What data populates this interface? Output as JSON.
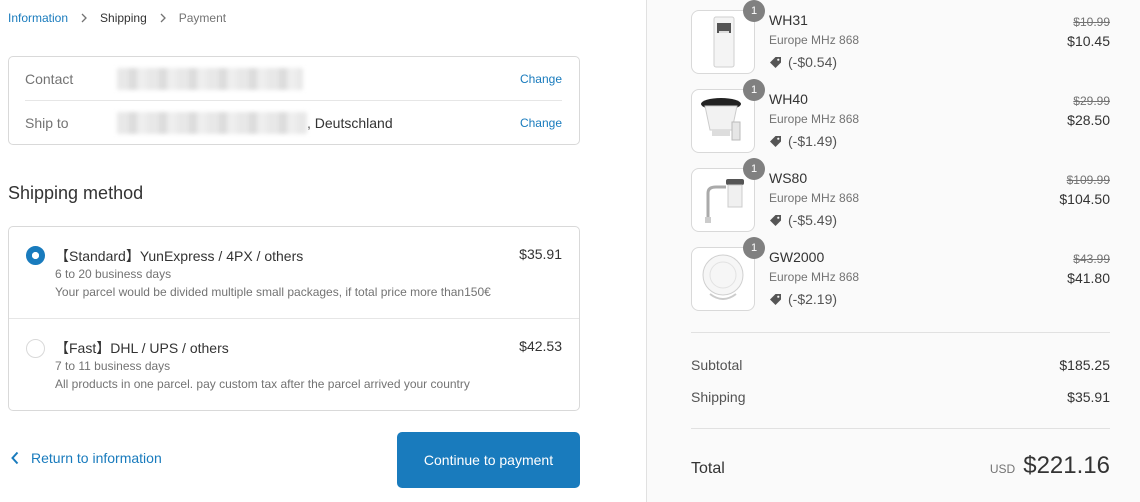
{
  "breadcrumb": {
    "items": [
      {
        "label": "Information",
        "state": "link"
      },
      {
        "label": "Shipping",
        "state": "current"
      },
      {
        "label": "Payment",
        "state": "upcoming"
      }
    ]
  },
  "review": {
    "contact_label": "Contact",
    "contact_change": "Change",
    "shipto_label": "Ship to",
    "shipto_value_suffix": ", Deutschland",
    "shipto_change": "Change"
  },
  "shipping_method": {
    "title": "Shipping method",
    "options": [
      {
        "selected": true,
        "title": "【Standard】YunExpress / 4PX / others",
        "price": "$35.91",
        "days": "6 to 20 business days",
        "note": "Your parcel would be divided multiple small packages, if total price more than150€"
      },
      {
        "selected": false,
        "title": "【Fast】DHL / UPS / others",
        "price": "$42.53",
        "days": "7 to 11 business days",
        "note": "All products in one parcel. pay custom tax after the parcel arrived your country"
      }
    ]
  },
  "footer": {
    "return_label": "Return to information",
    "continue_label": "Continue to payment"
  },
  "products": [
    {
      "name": "WH31",
      "variant": "Europe MHz 868",
      "discount": "(-$0.54)",
      "old_price": "$10.99",
      "price": "$10.45",
      "qty": "1"
    },
    {
      "name": "WH40",
      "variant": "Europe MHz 868",
      "discount": "(-$1.49)",
      "old_price": "$29.99",
      "price": "$28.50",
      "qty": "1"
    },
    {
      "name": "WS80",
      "variant": "Europe MHz 868",
      "discount": "(-$5.49)",
      "old_price": "$109.99",
      "price": "$104.50",
      "qty": "1"
    },
    {
      "name": "GW2000",
      "variant": "Europe MHz 868",
      "discount": "(-$2.19)",
      "old_price": "$43.99",
      "price": "$41.80",
      "qty": "1"
    }
  ],
  "summary": {
    "subtotal_label": "Subtotal",
    "subtotal_value": "$185.25",
    "shipping_label": "Shipping",
    "shipping_value": "$35.91",
    "total_label": "Total",
    "currency": "USD",
    "total_value": "$221.16"
  },
  "colors": {
    "accent": "#197bbd",
    "text": "#333333",
    "muted": "#737373",
    "sidebar_bg": "#fafafa"
  }
}
